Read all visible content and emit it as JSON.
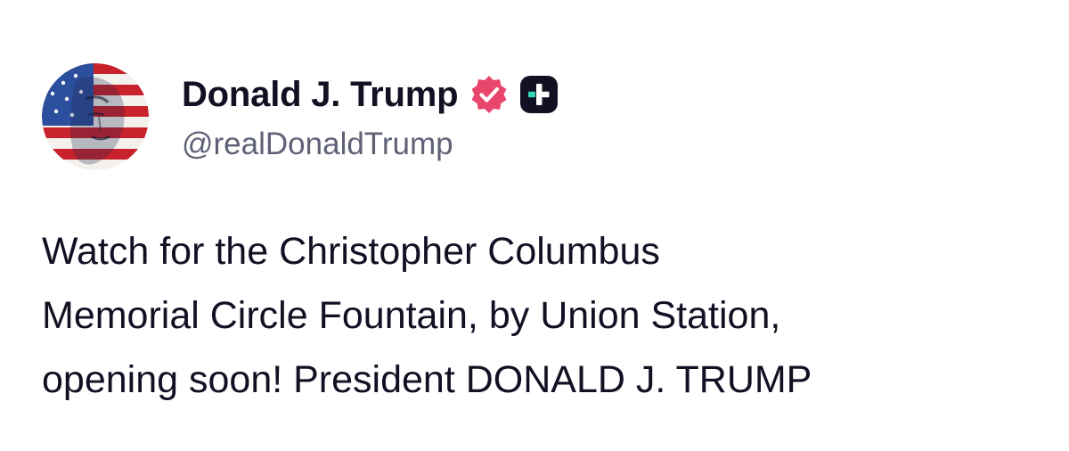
{
  "author": {
    "display_name": "Donald J. Trump",
    "handle": "@realDonaldTrump",
    "avatar_icon": "user-avatar",
    "verified_icon": "verified-badge-icon",
    "plus_icon": "truth-plus-icon"
  },
  "post": {
    "lines": [
      "Watch for the Christopher Columbus",
      "Memorial Circle Fountain, by Union Station,",
      "opening soon! President DONALD J. TRUMP"
    ]
  },
  "colors": {
    "text": "#121124",
    "handle": "#5f6277",
    "verified_badge": "#e8466c",
    "plus_badge": "#121124",
    "plus_accent": "#31d6b5"
  }
}
